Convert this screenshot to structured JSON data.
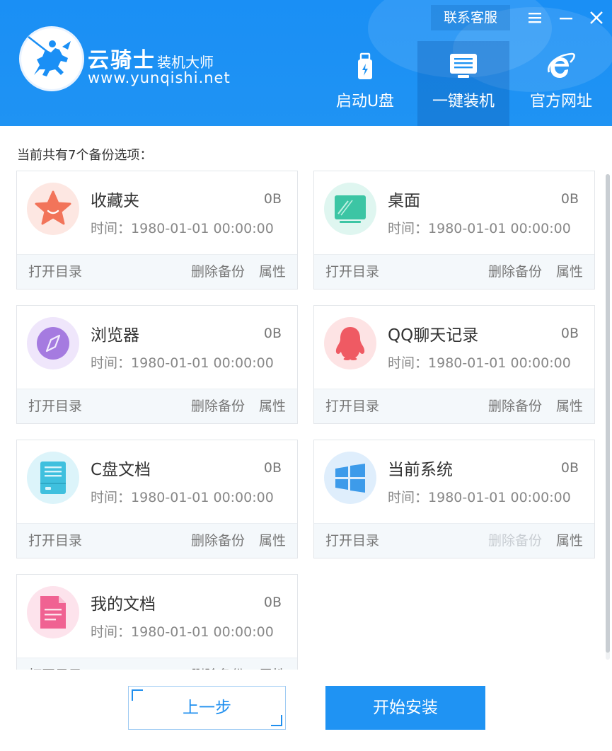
{
  "header": {
    "brand_name": "云骑士",
    "brand_sub": "装机大师",
    "brand_url": "www.yunqishi.net",
    "support_label": "联系客服",
    "window_controls": [
      "menu-icon",
      "minimize-icon",
      "close-icon"
    ],
    "nav": [
      {
        "label": "启动U盘",
        "icon": "usb-drive-icon",
        "active": false
      },
      {
        "label": "一键装机",
        "icon": "monitor-icon",
        "active": true
      },
      {
        "label": "官方网址",
        "icon": "ie-browser-icon",
        "active": false
      }
    ]
  },
  "main": {
    "title": "当前共有7个备份选项：",
    "time_prefix": "时间：",
    "actions": {
      "open": "打开目录",
      "delete": "删除备份",
      "properties": "属性"
    },
    "items": [
      {
        "name": "收藏夹",
        "size": "0B",
        "time": "1980-01-01 00:00:00",
        "icon": "favorites-star-icon",
        "delete_enabled": true
      },
      {
        "name": "桌面",
        "size": "0B",
        "time": "1980-01-01 00:00:00",
        "icon": "desktop-icon",
        "delete_enabled": true
      },
      {
        "name": "浏览器",
        "size": "0B",
        "time": "1980-01-01 00:00:00",
        "icon": "browser-compass-icon",
        "delete_enabled": true
      },
      {
        "name": "QQ聊天记录",
        "size": "0B",
        "time": "1980-01-01 00:00:00",
        "icon": "qq-penguin-icon",
        "delete_enabled": true
      },
      {
        "name": "C盘文档",
        "size": "0B",
        "time": "1980-01-01 00:00:00",
        "icon": "c-drive-document-icon",
        "delete_enabled": true
      },
      {
        "name": "当前系统",
        "size": "0B",
        "time": "1980-01-01 00:00:00",
        "icon": "windows-logo-icon",
        "delete_enabled": false
      },
      {
        "name": "我的文档",
        "size": "0B",
        "time": "1980-01-01 00:00:00",
        "icon": "my-documents-icon",
        "delete_enabled": true
      }
    ]
  },
  "footer": {
    "prev_label": "上一步",
    "install_label": "开始安装"
  },
  "colors": {
    "header_blue": "#1f93f3",
    "favorites": "#f2745a",
    "desktop": "#3cc5a4",
    "browser": "#a57be0",
    "qq": "#ef5a63",
    "c_drive": "#3fc0de",
    "windows": "#3d9bea",
    "my_documents": "#f06292"
  }
}
